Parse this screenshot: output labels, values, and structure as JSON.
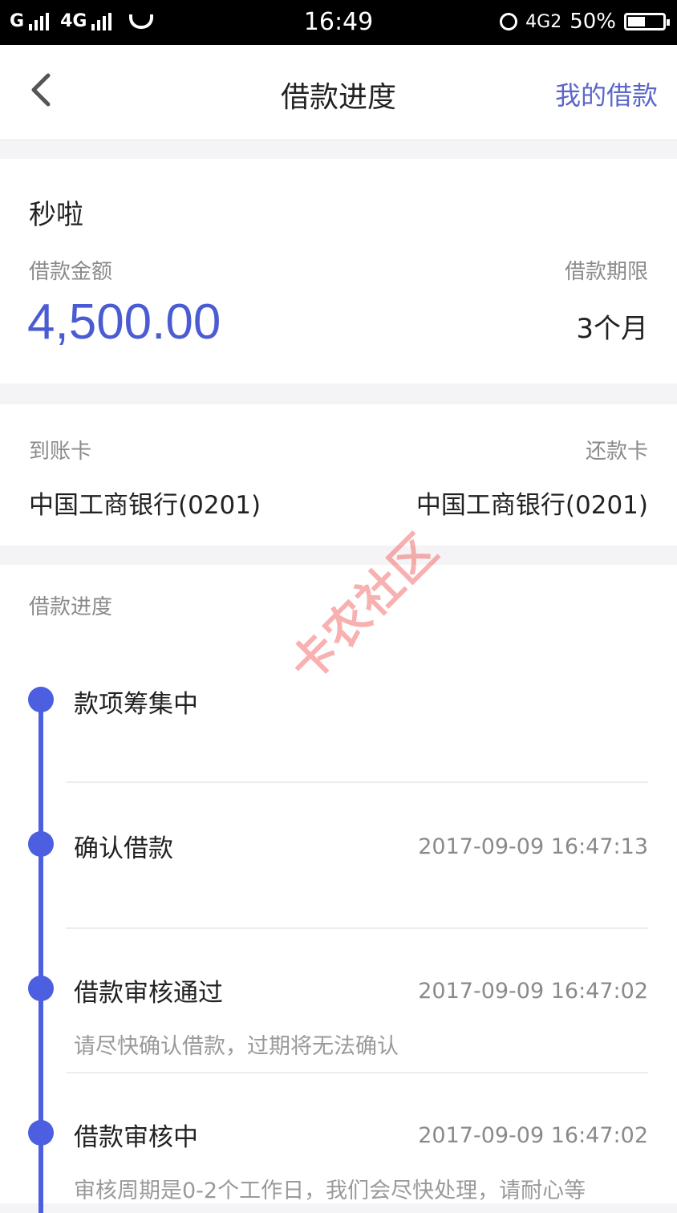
{
  "status_bar": {
    "carrier1": "G",
    "carrier2": "4G",
    "time": "16:49",
    "network": "4G2",
    "battery": "50%",
    "battery_level": 0.5
  },
  "nav": {
    "back_icon": "chevron-left-icon",
    "title": "借款进度",
    "right_link": "我的借款"
  },
  "loan": {
    "product": "秒啦",
    "amount_label": "借款金额",
    "amount": "4,500.00",
    "term_label": "借款期限",
    "term": "3个月"
  },
  "cards": {
    "receive_label": "到账卡",
    "receive_bank": "中国工商银行(0201)",
    "repay_label": "还款卡",
    "repay_bank": "中国工商银行(0201)"
  },
  "progress": {
    "title": "借款进度",
    "steps": [
      {
        "title": "款项筹集中",
        "time": "",
        "note": ""
      },
      {
        "title": "确认借款",
        "time": "2017-09-09 16:47:13",
        "note": ""
      },
      {
        "title": "借款审核通过",
        "time": "2017-09-09 16:47:02",
        "note": "请尽快确认借款，过期将无法确认"
      },
      {
        "title": "借款审核中",
        "time": "2017-09-09 16:47:02",
        "note": "审核周期是0-2个工作日，我们会尽快处理，请耐心等"
      }
    ]
  },
  "watermark": "卡农社区",
  "colors": {
    "accent": "#4b5fe0",
    "link": "#5b67c9",
    "amount": "#4a5bd4"
  }
}
